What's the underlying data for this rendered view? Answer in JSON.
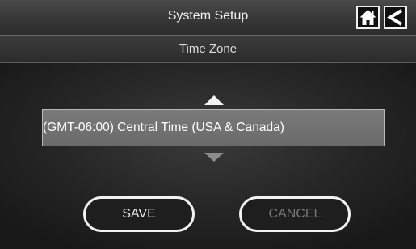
{
  "header": {
    "title": "System Setup",
    "home_icon": "home-icon",
    "back_icon": "back-arrow-icon"
  },
  "subheader": {
    "title": "Time Zone"
  },
  "timezone_picker": {
    "up_icon": "arrow-up-icon",
    "down_icon": "arrow-down-icon",
    "selected_value": "(GMT-06:00) Central Time (USA & Canada)"
  },
  "actions": {
    "save_label": "SAVE",
    "cancel_label": "CANCEL"
  },
  "colors": {
    "background": "#171717",
    "titlebar": "#3a3a3a",
    "selection_box": "#707070",
    "text_primary": "#f2f2f2",
    "text_disabled": "#7a7a7a"
  }
}
